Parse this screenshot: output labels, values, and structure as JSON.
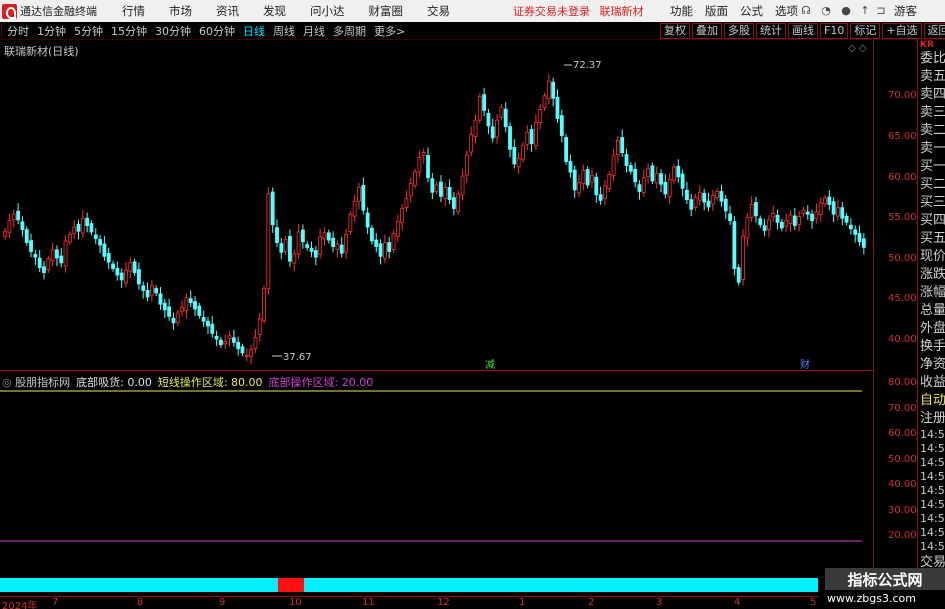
{
  "menubar": {
    "app_title": "通达信金融终端",
    "menus": [
      "行情",
      "市场",
      "资讯",
      "发现",
      "问小达",
      "财富圈",
      "交易"
    ],
    "notice": [
      "证券交易未登录",
      "联瑞新材"
    ],
    "right_menus": [
      "功能",
      "版面",
      "公式",
      "选项"
    ],
    "guest": "游客"
  },
  "periodbar": {
    "periods": [
      "分时",
      "1分钟",
      "5分钟",
      "15分钟",
      "30分钟",
      "60分钟",
      "日线",
      "周线",
      "月线",
      "多周期",
      "更多>"
    ],
    "active": "日线",
    "tools": [
      "复权",
      "叠加",
      "多股",
      "统计",
      "画线",
      "F10",
      "标记",
      "+自选",
      "返回"
    ]
  },
  "chart": {
    "title": "联瑞新材(日线)",
    "corner_icons": "◇ ◇",
    "high_label": "72.37",
    "low_label": "37.67",
    "markers": [
      "减",
      "财"
    ],
    "price_ticks": [
      "70.00",
      "65.00",
      "60.00",
      "55.00",
      "50.00",
      "45.00",
      "40.00"
    ],
    "up_color": "#ff3030",
    "down_color": "#54ffff"
  },
  "indicator": {
    "name": "股朋指标网",
    "items": [
      {
        "label": "底部吸货:",
        "value": "0.00",
        "color": "#e0e0e0"
      },
      {
        "label": "短线操作区域:",
        "value": "80.00",
        "color": "#e8e860"
      },
      {
        "label": "底部操作区域:",
        "value": "20.00",
        "color": "#d040d0"
      }
    ],
    "ticks": [
      "80.00",
      "70.00",
      "60.00",
      "50.00",
      "40.00",
      "30.00",
      "20.00"
    ]
  },
  "date_axis": [
    "2024年",
    "7",
    "8",
    "9",
    "10",
    "11",
    "12",
    "1",
    "2",
    "3",
    "4",
    "5"
  ],
  "side_panel": {
    "items": [
      "委比",
      "卖五",
      "卖四",
      "卖三",
      "卖二",
      "卖一",
      "买一",
      "买二",
      "买三",
      "买四",
      "买五",
      "现价",
      "涨跌",
      "涨幅",
      "总量",
      "外盘",
      "换手",
      "净资",
      "收益",
      "自动",
      "注册",
      "交易"
    ],
    "times": [
      "14:5",
      "14:5",
      "14:5",
      "14:5",
      "14:5",
      "14:5",
      "14:5",
      "14:5",
      "14:5"
    ],
    "top_code": "KR"
  },
  "watermark": {
    "name": "指标公式网",
    "url": "www.zbgs3.com"
  },
  "chart_data": {
    "type": "candlestick",
    "y_range": [
      37,
      74
    ],
    "closes": [
      53.5,
      54.8,
      55.6,
      54.9,
      53.7,
      52.1,
      51.0,
      50.3,
      49.0,
      48.4,
      50.1,
      51.2,
      50.2,
      49.6,
      52.3,
      53.1,
      54.0,
      53.5,
      55.1,
      54.2,
      53.4,
      52.6,
      51.8,
      50.4,
      49.7,
      48.9,
      48.1,
      47.5,
      48.7,
      49.6,
      48.4,
      47.0,
      46.2,
      45.4,
      46.8,
      45.9,
      44.5,
      43.8,
      43.0,
      42.2,
      43.4,
      44.1,
      45.3,
      44.7,
      43.9,
      43.1,
      42.4,
      41.8,
      40.9,
      40.2,
      39.5,
      39.9,
      40.6,
      39.8,
      39.0,
      38.5,
      38.2,
      38.9,
      40.4,
      42.7,
      46.4,
      58.1,
      54.3,
      52.1,
      50.9,
      52.5,
      49.8,
      50.7,
      53.4,
      52.2,
      51.5,
      51.0,
      50.3,
      52.8,
      53.3,
      52.4,
      51.6,
      51.9,
      50.8,
      53.1,
      55.6,
      57.2,
      58.9,
      56.1,
      54.0,
      52.3,
      51.6,
      50.4,
      52.1,
      51.0,
      53.2,
      54.7,
      56.3,
      57.5,
      59.4,
      60.8,
      62.6,
      63.2,
      60.1,
      58.3,
      59.2,
      57.8,
      58.9,
      57.4,
      56.3,
      58.1,
      60.3,
      62.9,
      65.4,
      67.2,
      70.1,
      68.4,
      66.5,
      65.0,
      67.2,
      68.8,
      66.4,
      63.6,
      61.8,
      62.5,
      64.1,
      65.7,
      64.3,
      66.9,
      68.5,
      70.2,
      72.0,
      69.9,
      67.4,
      65.3,
      62.1,
      60.8,
      58.6,
      59.5,
      61.0,
      59.2,
      60.4,
      58.0,
      57.3,
      59.1,
      60.5,
      62.8,
      64.7,
      63.2,
      61.6,
      60.9,
      59.6,
      58.4,
      60.1,
      61.2,
      59.7,
      60.6,
      59.3,
      58.1,
      59.9,
      61.4,
      60.2,
      58.8,
      57.4,
      56.2,
      57.7,
      58.3,
      57.1,
      56.5,
      57.9,
      58.4,
      57.2,
      56.0,
      54.8,
      48.9,
      47.2,
      52.9,
      55.2,
      56.8,
      55.4,
      54.3,
      53.6,
      54.9,
      55.7,
      54.6,
      53.9,
      54.8,
      55.5,
      54.2,
      55.3,
      56.1,
      55.6,
      54.8,
      55.9,
      57.0,
      57.6,
      56.8,
      55.6,
      56.4,
      55.1,
      54.6,
      53.8,
      53.1,
      52.2,
      51.5
    ]
  }
}
